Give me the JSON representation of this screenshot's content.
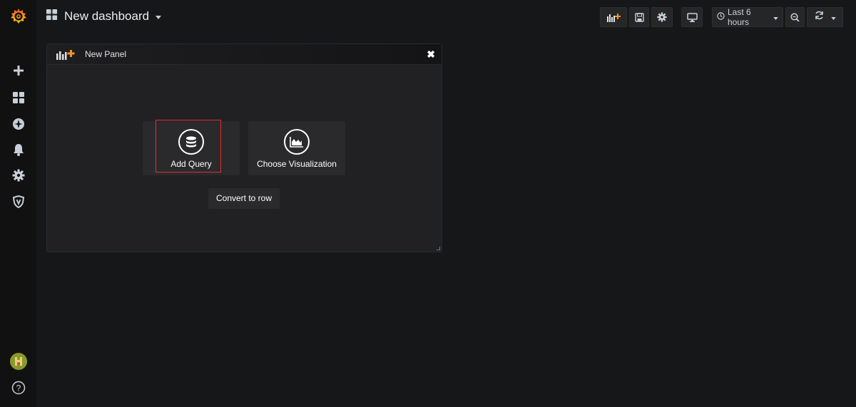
{
  "header": {
    "title": "New dashboard",
    "time_range": "Last 6 hours"
  },
  "panel": {
    "title": "New Panel",
    "close_glyph": "✖",
    "actions": [
      {
        "label": "Add Query",
        "icon": "database-icon"
      },
      {
        "label": "Choose Visualization",
        "icon": "area-chart-icon"
      }
    ],
    "convert_label": "Convert to row"
  },
  "sidebar": {
    "items": [
      "grafana-logo-icon",
      "plus-icon",
      "dashboards-icon",
      "explore-icon",
      "bell-icon",
      "gear-icon",
      "shield-icon"
    ],
    "bottom": [
      "avatar",
      "help-icon"
    ]
  },
  "colors": {
    "background": "#161719",
    "highlight": "#e02f2f",
    "logo": "#f46800"
  }
}
